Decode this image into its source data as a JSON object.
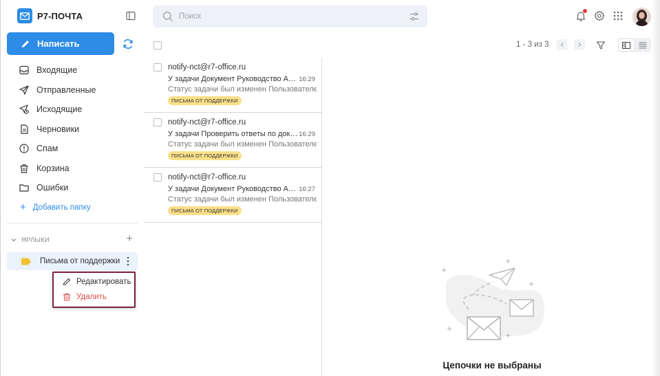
{
  "app": {
    "title": "Р7-ПОЧТА"
  },
  "compose": {
    "label": "Написать"
  },
  "folders": [
    {
      "label": "Входящие",
      "icon": "inbox-icon"
    },
    {
      "label": "Отправленные",
      "icon": "send-icon"
    },
    {
      "label": "Исходящие",
      "icon": "outbox-icon"
    },
    {
      "label": "Черновики",
      "icon": "draft-icon"
    },
    {
      "label": "Спам",
      "icon": "spam-icon"
    },
    {
      "label": "Корзина",
      "icon": "trash-icon"
    },
    {
      "label": "Ошибки",
      "icon": "folder-icon"
    }
  ],
  "add_folder": {
    "label": "Добавить папку"
  },
  "labels_section": {
    "title": "ЯРЛЫКИ",
    "items": [
      {
        "label": "Письма от поддержки",
        "color": "#f2c232"
      }
    ]
  },
  "context_menu": {
    "edit": "Редактировать",
    "delete": "Удалить"
  },
  "search": {
    "placeholder": "Поиск"
  },
  "pager": {
    "text": "1 - 3 из 3"
  },
  "mails": [
    {
      "from": "notify-nct@r7-office.ru",
      "subject": "У задачи Документ Руководство Администратора",
      "time": "16:29",
      "preview": "Статус задачи был изменен Пользователем",
      "badge": "ПИСЬМА ОТ ПОДДЕРЖКИ"
    },
    {
      "from": "notify-nct@r7-office.ru",
      "subject": "У задачи Проверить ответы по документу",
      "time": "16:29",
      "preview": "Статус задачи был изменен Пользователем",
      "badge": "ПИСЬМА ОТ ПОДДЕРЖКИ"
    },
    {
      "from": "notify-nct@r7-office.ru",
      "subject": "У задачи Документ Руководство Администратора",
      "time": "16:27",
      "preview": "Статус задачи был изменен Пользователем",
      "badge": "ПИСЬМА ОТ ПОДДЕРЖКИ"
    }
  ],
  "empty_state": {
    "text": "Цепочки не выбраны"
  },
  "colors": {
    "accent": "#2d8ce6",
    "badge": "#fbe08a",
    "danger": "#e04b4b",
    "notify_dot": "#ee3a3a"
  }
}
